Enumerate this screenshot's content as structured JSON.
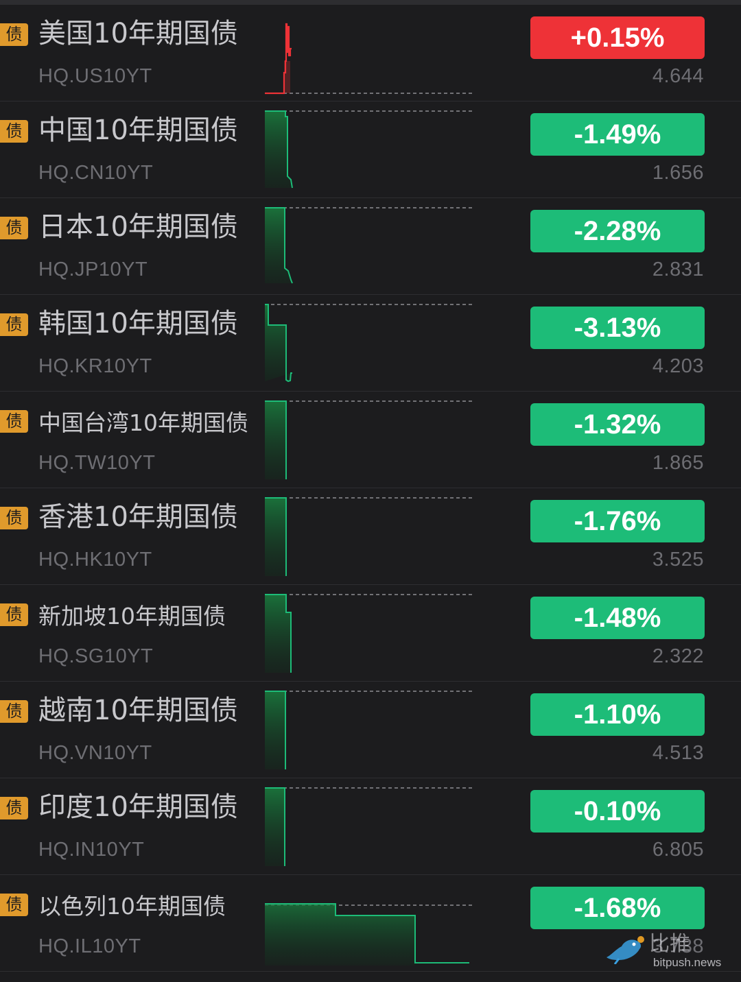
{
  "tag_label": "债",
  "colors": {
    "up": "#ee3237",
    "down": "#1dbc78",
    "tag": "#e09a2c",
    "background": "#1c1c1e"
  },
  "rows": [
    {
      "name": "美国10年期国债",
      "code": "HQ.US10YT",
      "change": "+0.15%",
      "price": "4.644",
      "direction": "up"
    },
    {
      "name": "中国10年期国债",
      "code": "HQ.CN10YT",
      "change": "-1.49%",
      "price": "1.656",
      "direction": "down"
    },
    {
      "name": "日本10年期国债",
      "code": "HQ.JP10YT",
      "change": "-2.28%",
      "price": "2.831",
      "direction": "down"
    },
    {
      "name": "韩国10年期国债",
      "code": "HQ.KR10YT",
      "change": "-3.13%",
      "price": "4.203",
      "direction": "down"
    },
    {
      "name": "中国台湾10年期国债",
      "code": "HQ.TW10YT",
      "change": "-1.32%",
      "price": "1.865",
      "direction": "down"
    },
    {
      "name": "香港10年期国债",
      "code": "HQ.HK10YT",
      "change": "-1.76%",
      "price": "3.525",
      "direction": "down"
    },
    {
      "name": "新加坡10年期国债",
      "code": "HQ.SG10YT",
      "change": "-1.48%",
      "price": "2.322",
      "direction": "down"
    },
    {
      "name": "越南10年期国债",
      "code": "HQ.VN10YT",
      "change": "-1.10%",
      "price": "4.513",
      "direction": "down"
    },
    {
      "name": "印度10年期国债",
      "code": "HQ.IN10YT",
      "change": "-0.10%",
      "price": "6.805",
      "direction": "down"
    },
    {
      "name": "以色列10年期国债",
      "code": "HQ.IL10YT",
      "change": "-1.68%",
      "price": "3.738",
      "direction": "down"
    }
  ],
  "watermark": {
    "title": "比推",
    "url": "bitpush.news"
  }
}
